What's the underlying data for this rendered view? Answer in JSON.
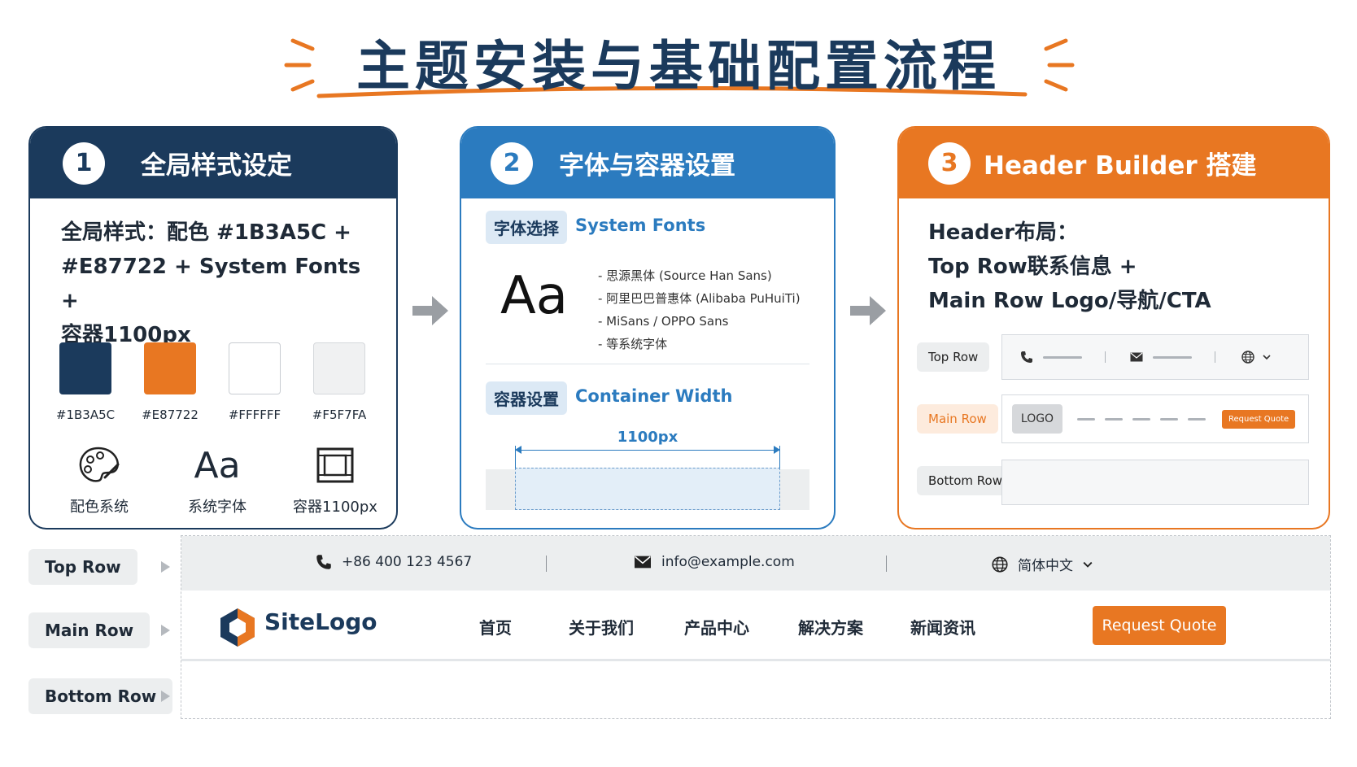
{
  "title": "主题安装与基础配置流程",
  "colors": {
    "primary": "#1B3A5C",
    "accent": "#E87722",
    "blue": "#2B7BBF",
    "white": "#FFFFFF",
    "light": "#F5F7FA"
  },
  "panel1": {
    "number": "1",
    "title": "全局样式设定",
    "desc_lines": [
      "全局样式：配色 #1B3A5C +",
      "#E87722 + System Fonts +",
      "容器1100px"
    ],
    "swatches": [
      {
        "code": "#1B3A5C",
        "color": "#1B3A5C"
      },
      {
        "code": "#E87722",
        "color": "#E87722"
      },
      {
        "code": "#FFFFFF",
        "color": "#FFFFFF"
      },
      {
        "code": "#F5F7FA",
        "color": "#F0F1F2"
      }
    ],
    "icons": [
      {
        "icon": "palette-icon",
        "label": "配色系统"
      },
      {
        "icon": "font-aa-icon",
        "glyph": "Aa",
        "label": "系统字体"
      },
      {
        "icon": "container-icon",
        "label": "容器1100px"
      }
    ]
  },
  "panel2": {
    "number": "2",
    "title": "字体与容器设置",
    "font_tag": "字体选择",
    "font_value": "System Fonts",
    "sample": "Aa",
    "font_list": [
      "- 思源黑体 (Source Han Sans)",
      "- 阿里巴巴普惠体 (Alibaba PuHuiTi)",
      "- MiSans / OPPO Sans",
      "- 等系统字体"
    ],
    "container_tag": "容器设置",
    "container_value": "Container Width",
    "width_label": "1100px"
  },
  "panel3": {
    "number": "3",
    "title": "Header Builder 搭建",
    "desc_lines": [
      "Header布局：",
      "Top Row联系信息 +",
      "Main Row Logo/导航/CTA"
    ],
    "rows": {
      "top": "Top Row",
      "main": "Main Row",
      "bottom": "Bottom Row"
    },
    "logo": "LOGO",
    "cta": "Request Quote"
  },
  "preview": {
    "row_tags": {
      "top": "Top Row",
      "main": "Main Row",
      "bottom": "Bottom Row"
    },
    "phone": "+86 400 123 4567",
    "email": "info@example.com",
    "language": "简体中文",
    "logo_text": "SiteLogo",
    "nav": [
      "首页",
      "关于我们",
      "产品中心",
      "解决方案",
      "新闻资讯"
    ],
    "cta": "Request Quote"
  }
}
